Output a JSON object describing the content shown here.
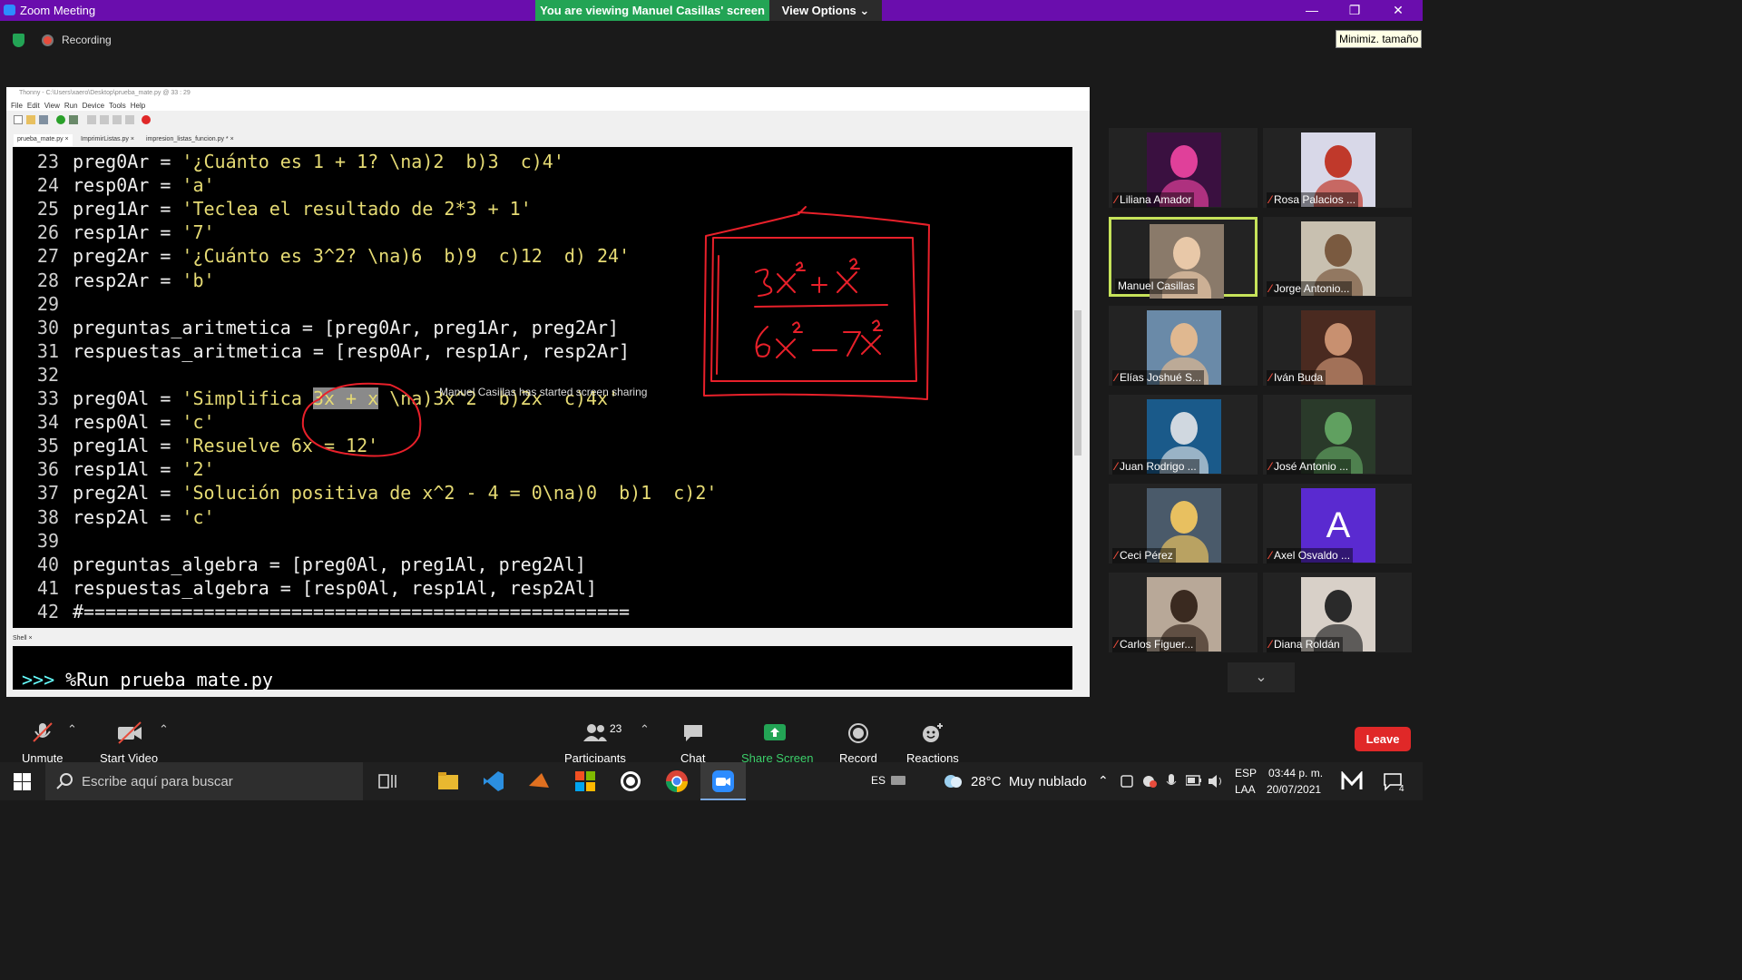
{
  "zoom": {
    "title": "Zoom Meeting",
    "viewing_banner": "You are viewing Manuel Casillas' screen",
    "view_options": "View Options",
    "recording": "Recording",
    "tooltip": "Minimiz. tamaño",
    "sharing_note": "Manuel Casillas has started screen sharing"
  },
  "thonny": {
    "title": "Thonny - C:\\Users\\xaero\\Desktop\\prueba_mate.py @ 33 : 29",
    "menu": [
      "File",
      "Edit",
      "View",
      "Run",
      "Device",
      "Tools",
      "Help"
    ],
    "tabs": [
      "prueba_mate.py ×",
      "ImprimirListas.py ×",
      "impresion_listas_funcion.py * ×"
    ],
    "shell_tab": "Shell ×",
    "shell_prompt": ">>> ",
    "shell_command": "%Run prueba_mate.py",
    "lines": [
      {
        "n": "23",
        "code": "preg0Ar = ",
        "str": "'¿Cuánto es 1 + 1? \\na)2  b)3  c)4'"
      },
      {
        "n": "24",
        "code": "resp0Ar = ",
        "str": "'a'"
      },
      {
        "n": "25",
        "code": "preg1Ar = ",
        "str": "'Teclea el resultado de 2*3 + 1'"
      },
      {
        "n": "26",
        "code": "resp1Ar = ",
        "str": "'7'"
      },
      {
        "n": "27",
        "code": "preg2Ar = ",
        "str": "'¿Cuánto es 3^2? \\na)6  b)9  c)12  d) 24'"
      },
      {
        "n": "28",
        "code": "resp2Ar = ",
        "str": "'b'"
      },
      {
        "n": "29",
        "code": "",
        "str": ""
      },
      {
        "n": "30",
        "code": "preguntas_aritmetica = [preg0Ar, preg1Ar, preg2Ar]",
        "str": ""
      },
      {
        "n": "31",
        "code": "respuestas_aritmetica = [resp0Ar, resp1Ar, resp2Ar]",
        "str": ""
      },
      {
        "n": "32",
        "code": "",
        "str": ""
      },
      {
        "n": "33",
        "code": "preg0Al = ",
        "str": "'Simplifica ",
        "sel": "3x + x",
        "str2": " \\na)3x^2  b)2x  c)4x'"
      },
      {
        "n": "34",
        "code": "resp0Al = ",
        "str": "'c'"
      },
      {
        "n": "35",
        "code": "preg1Al = ",
        "str": "'Resuelve 6x = 12'"
      },
      {
        "n": "36",
        "code": "resp1Al = ",
        "str": "'2'"
      },
      {
        "n": "37",
        "code": "preg2Al = ",
        "str": "'Solución positiva de x^2 - 4 = 0\\na)0  b)1  c)2'"
      },
      {
        "n": "38",
        "code": "resp2Al = ",
        "str": "'c'"
      },
      {
        "n": "39",
        "code": "",
        "str": ""
      },
      {
        "n": "40",
        "code": "preguntas_algebra = [preg0Al, preg1Al, preg2Al]",
        "str": ""
      },
      {
        "n": "41",
        "code": "respuestas_algebra = [resp0Al, resp1Al, resp2Al]",
        "str": ""
      },
      {
        "n": "42",
        "code": "#==================================================",
        "str": ""
      }
    ]
  },
  "participants": [
    {
      "name": "Liliana Amador",
      "muted": true,
      "bg": "#3a1040",
      "accent": "#e0409a"
    },
    {
      "name": "Rosa Palacios ...",
      "muted": true,
      "bg": "#d8d8e8",
      "accent": "#c0392b"
    },
    {
      "name": "Manuel Casillas",
      "muted": false,
      "bg": "#8a7a6a",
      "accent": "#e8c8a8",
      "active": true
    },
    {
      "name": "Jorge Antonio...",
      "muted": true,
      "bg": "#c8c0b0",
      "accent": "#7a5a40"
    },
    {
      "name": "Elías Joshué S...",
      "muted": true,
      "bg": "#6a8aa8",
      "accent": "#e0b890"
    },
    {
      "name": "Iván Buda",
      "muted": true,
      "bg": "#4a2a20",
      "accent": "#c89070"
    },
    {
      "name": "Juan Rodrigo ...",
      "muted": true,
      "bg": "#1a5a8a",
      "accent": "#d0d8e0"
    },
    {
      "name": "José Antonio ...",
      "muted": true,
      "bg": "#2a3a2a",
      "accent": "#60a060"
    },
    {
      "name": "Ceci Pérez",
      "muted": true,
      "bg": "#4a5a6a",
      "accent": "#e8c060"
    },
    {
      "name": "Axel Osvaldo ...",
      "muted": true,
      "bg": "#5a2ad0",
      "accent": "#ffffff",
      "initial": "A"
    },
    {
      "name": "Carlos Figuer...",
      "muted": true,
      "bg": "#b8a898",
      "accent": "#3a2a20"
    },
    {
      "name": "Diana Roldán",
      "muted": true,
      "bg": "#d8d0c8",
      "accent": "#2a2a2a"
    }
  ],
  "toolbar": {
    "unmute": "Unmute",
    "start_video": "Start Video",
    "participants": "Participants",
    "participants_count": "23",
    "chat": "Chat",
    "share_screen": "Share Screen",
    "record": "Record",
    "reactions": "Reactions",
    "leave": "Leave"
  },
  "taskbar": {
    "search_placeholder": "Escribe aquí para buscar",
    "lang": "ES",
    "weather": "28°C  Muy nublado",
    "input_lang": "ESP",
    "input_layout": "LAA",
    "time": "03:44 p. m.",
    "date": "20/07/2021",
    "notifications": "4"
  },
  "colors": {
    "zoom_purple": "#6a0dad",
    "banner_green": "#23a455",
    "string_yellow": "#e6db74",
    "annotation_red": "#e8202a",
    "leave_red": "#e02828"
  }
}
